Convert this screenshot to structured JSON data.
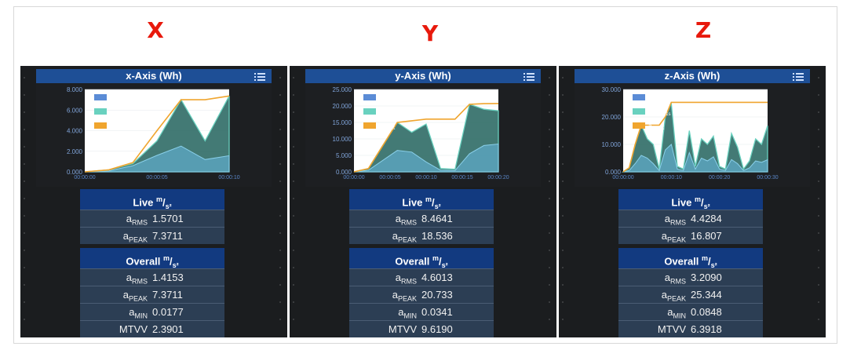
{
  "labels": {
    "x": "X",
    "y": "Y",
    "z": "Z"
  },
  "colors": {
    "rms": "#5b8cd6",
    "peak_fill": "#69d1bf",
    "peak_run": "#f0a52e",
    "header": "#1e4f96",
    "card_title": "#123a80",
    "card_body": "#2c3e54"
  },
  "panels": [
    {
      "id": "x",
      "title": "x-Axis (Wh)",
      "menu_icon": "list-icon",
      "legend": [
        {
          "base": "a",
          "sub": "RMS,1s"
        },
        {
          "base": "a",
          "sub": "PEAK,1s"
        },
        {
          "base": "a",
          "sub": "PEAK"
        }
      ],
      "chart_data": {
        "type": "area",
        "y_ticks": [
          "8.000",
          "6.000",
          "4.000",
          "2.000",
          "0.000"
        ],
        "x_ticks": [
          "00:00:00",
          "00:00:05",
          "00:00:10"
        ],
        "ylim": [
          0,
          8
        ],
        "x": [
          0,
          1,
          2,
          3,
          4,
          5,
          6
        ],
        "series": [
          {
            "key": "rms",
            "values": [
              0,
              0.1,
              0.6,
              1.6,
              2.5,
              1.2,
              1.57
            ]
          },
          {
            "key": "peak1s",
            "values": [
              0,
              0.2,
              0.8,
              3.0,
              7.0,
              3.0,
              7.37
            ]
          },
          {
            "key": "peak",
            "values": [
              0,
              0.2,
              0.9,
              4.0,
              7.0,
              7.0,
              7.37
            ]
          }
        ]
      },
      "live": {
        "title": "Live",
        "unit": {
          "num": "m",
          "den": "s²"
        },
        "rows": [
          {
            "base": "a",
            "sub": "RMS",
            "value": "1.5701"
          },
          {
            "base": "a",
            "sub": "PEAK",
            "value": "7.3711"
          }
        ]
      },
      "overall": {
        "title": "Overall",
        "unit": {
          "num": "m",
          "den": "s²"
        },
        "rows": [
          {
            "base": "a",
            "sub": "RMS",
            "value": "1.4153"
          },
          {
            "base": "a",
            "sub": "PEAK",
            "value": "7.3711"
          },
          {
            "base": "a",
            "sub": "MIN",
            "value": "0.0177"
          },
          {
            "base": "MTVV",
            "sub": "",
            "value": "2.3901"
          }
        ]
      }
    },
    {
      "id": "y",
      "title": "y-Axis (Wh)",
      "menu_icon": "list-icon",
      "legend": [
        {
          "base": "a",
          "sub": "RMS,1s"
        },
        {
          "base": "a",
          "sub": "PEAK,1s"
        },
        {
          "base": "a",
          "sub": "PEAK"
        }
      ],
      "chart_data": {
        "type": "area",
        "y_ticks": [
          "25.000",
          "20.000",
          "15.000",
          "10.000",
          "5.000",
          "0.000"
        ],
        "x_ticks": [
          "00:00:00",
          "00:00:05",
          "00:00:10",
          "00:00:15",
          "00:00:20"
        ],
        "ylim": [
          0,
          25
        ],
        "x": [
          0,
          1,
          2,
          3,
          4,
          5,
          6,
          7,
          8,
          9,
          10
        ],
        "series": [
          {
            "key": "rms",
            "values": [
              0,
              0.5,
              3.5,
              6.5,
              6.0,
              3.0,
              0.5,
              0.4,
              5.5,
              8.0,
              8.46
            ]
          },
          {
            "key": "peak1s",
            "values": [
              0,
              1.0,
              8.0,
              15.0,
              12.0,
              14.5,
              1.0,
              0.8,
              20.5,
              19.0,
              18.54
            ]
          },
          {
            "key": "peak",
            "values": [
              0,
              1.0,
              8.0,
              15.0,
              15.5,
              16.0,
              16.0,
              16.0,
              20.5,
              20.7,
              20.73
            ]
          }
        ]
      },
      "live": {
        "title": "Live",
        "unit": {
          "num": "m",
          "den": "s²"
        },
        "rows": [
          {
            "base": "a",
            "sub": "RMS",
            "value": "8.4641"
          },
          {
            "base": "a",
            "sub": "PEAK",
            "value": "18.536"
          }
        ]
      },
      "overall": {
        "title": "Overall",
        "unit": {
          "num": "m",
          "den": "s²"
        },
        "rows": [
          {
            "base": "a",
            "sub": "RMS",
            "value": "4.6013"
          },
          {
            "base": "a",
            "sub": "PEAK",
            "value": "20.733"
          },
          {
            "base": "a",
            "sub": "MIN",
            "value": "0.0341"
          },
          {
            "base": "MTVV",
            "sub": "",
            "value": "9.6190"
          }
        ]
      }
    },
    {
      "id": "z",
      "title": "z-Axis (Wh)",
      "menu_icon": "list-icon",
      "legend": [
        {
          "base": "a",
          "sub": "RMS,1s"
        },
        {
          "base": "a",
          "sub": "PEAK,1s"
        },
        {
          "base": "a",
          "sub": "PEAK"
        }
      ],
      "chart_data": {
        "type": "area",
        "y_ticks": [
          "30.000",
          "20.000",
          "10.000",
          "0.000"
        ],
        "x_ticks": [
          "00:00:00",
          "00:00:10",
          "00:00:20",
          "00:00:30"
        ],
        "ylim": [
          0,
          30
        ],
        "x": [
          0,
          1,
          2,
          3,
          4,
          5,
          6,
          7,
          8,
          9,
          10,
          11,
          12,
          13,
          14,
          15,
          16,
          17,
          18,
          19,
          20,
          21,
          22,
          23,
          24
        ],
        "series": [
          {
            "key": "rms",
            "values": [
              0,
              0.5,
              3.0,
              6.0,
              5.0,
              3.0,
              0.5,
              8.0,
              10.0,
              1.0,
              0.5,
              7.0,
              1.0,
              5.0,
              4.0,
              5.5,
              1.0,
              0.5,
              4.5,
              3.0,
              0.5,
              1.5,
              4.0,
              3.5,
              4.43
            ]
          },
          {
            "key": "peak1s",
            "values": [
              0,
              1.5,
              10.0,
              17.0,
              12.0,
              10.0,
              1.0,
              20.0,
              25.0,
              2.0,
              1.0,
              15.0,
              2.0,
              12.0,
              10.0,
              13.0,
              2.0,
              1.0,
              14.0,
              9.0,
              1.0,
              4.0,
              12.0,
              10.0,
              16.8
            ]
          },
          {
            "key": "peak",
            "values": [
              0,
              1.5,
              10.0,
              17.0,
              17.0,
              17.0,
              17.0,
              20.0,
              25.3,
              25.3,
              25.3,
              25.3,
              25.3,
              25.3,
              25.3,
              25.3,
              25.3,
              25.3,
              25.3,
              25.3,
              25.3,
              25.3,
              25.3,
              25.3,
              25.3
            ]
          }
        ]
      },
      "live": {
        "title": "Live",
        "unit": {
          "num": "m",
          "den": "s²"
        },
        "rows": [
          {
            "base": "a",
            "sub": "RMS",
            "value": "4.4284"
          },
          {
            "base": "a",
            "sub": "PEAK",
            "value": "16.807"
          }
        ]
      },
      "overall": {
        "title": "Overall",
        "unit": {
          "num": "m",
          "den": "s²"
        },
        "rows": [
          {
            "base": "a",
            "sub": "RMS",
            "value": "3.2090"
          },
          {
            "base": "a",
            "sub": "PEAK",
            "value": "25.344"
          },
          {
            "base": "a",
            "sub": "MIN",
            "value": "0.0848"
          },
          {
            "base": "MTVV",
            "sub": "",
            "value": "6.3918"
          }
        ]
      }
    }
  ]
}
